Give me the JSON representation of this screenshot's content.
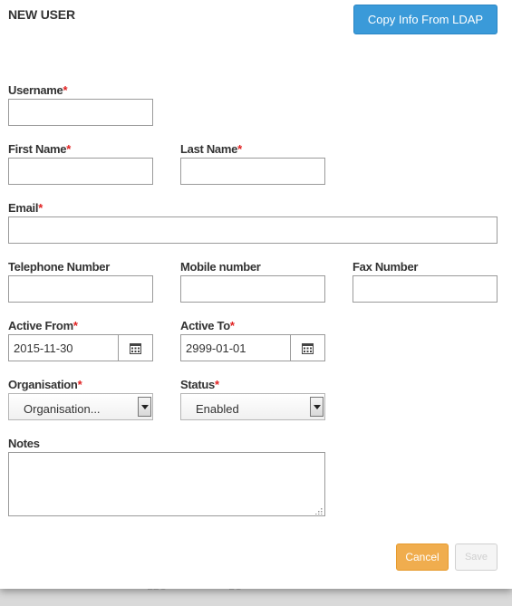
{
  "backdrop": {
    "fragment_1": "LLC",
    "fragment_2": "LC"
  },
  "modal": {
    "title": "NEW USER",
    "ldap_button": "Copy Info From LDAP"
  },
  "fields": {
    "username": {
      "label": "Username",
      "required": "*",
      "value": ""
    },
    "first_name": {
      "label": "First Name",
      "required": "*",
      "value": ""
    },
    "last_name": {
      "label": "Last Name",
      "required": "*",
      "value": ""
    },
    "email": {
      "label": "Email",
      "required": "*",
      "value": ""
    },
    "telephone": {
      "label": "Telephone Number",
      "value": ""
    },
    "mobile": {
      "label": "Mobile number",
      "value": ""
    },
    "fax": {
      "label": "Fax Number",
      "value": ""
    },
    "active_from": {
      "label": "Active From",
      "required": "*",
      "value": "2015-11-30",
      "icon": "calendar-icon"
    },
    "active_to": {
      "label": "Active To",
      "required": "*",
      "value": "2999-01-01",
      "icon": "calendar-icon"
    },
    "organisation": {
      "label": "Organisation",
      "required": "*",
      "value": "Organisation..."
    },
    "status": {
      "label": "Status",
      "required": "*",
      "value": "Enabled"
    },
    "notes": {
      "label": "Notes",
      "value": ""
    }
  },
  "buttons": {
    "cancel": "Cancel",
    "save": "Save"
  },
  "colors": {
    "primary": "#3a9ad9",
    "warning": "#f0ad4e",
    "required": "#e02020"
  }
}
